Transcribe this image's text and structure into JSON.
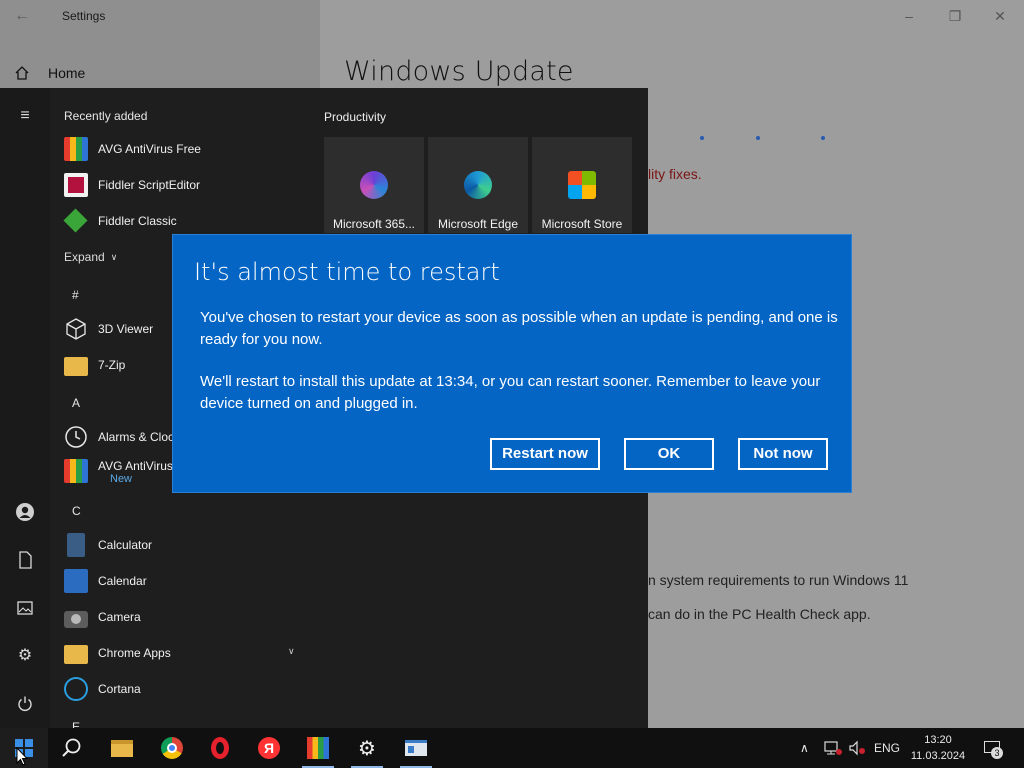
{
  "settings": {
    "window_title": "Settings",
    "home_label": "Home",
    "page_title": "Windows Update",
    "fragment_quality": "lity fixes.",
    "fragment_requirements": "n system requirements to run Windows 11",
    "fragment_health": "can do in the PC Health Check app."
  },
  "start_menu": {
    "recently_added_label": "Recently added",
    "recent": [
      {
        "label": "AVG AntiVirus Free",
        "icon": "avg-icon"
      },
      {
        "label": "Fiddler ScriptEditor",
        "icon": "fiddler-scripteditor-icon"
      },
      {
        "label": "Fiddler Classic",
        "icon": "fiddler-classic-icon"
      }
    ],
    "expand_label": "Expand",
    "sections": [
      {
        "header": "#",
        "apps": [
          {
            "label": "3D Viewer"
          },
          {
            "label": "7-Zip"
          }
        ]
      },
      {
        "header": "A",
        "apps": [
          {
            "label": "Alarms & Cloc"
          },
          {
            "label": "AVG AntiVirus",
            "badge": "New"
          }
        ]
      },
      {
        "header": "C",
        "apps": [
          {
            "label": "Calculator"
          },
          {
            "label": "Calendar"
          },
          {
            "label": "Camera"
          },
          {
            "label": "Chrome Apps"
          },
          {
            "label": "Cortana"
          }
        ]
      },
      {
        "header": "E"
      }
    ],
    "tiles_group": "Productivity",
    "tiles": [
      {
        "label": "Microsoft 365..."
      },
      {
        "label": "Microsoft Edge"
      },
      {
        "label": "Microsoft Store"
      }
    ]
  },
  "dialog": {
    "title": "It's almost time to restart",
    "paragraph1": "You've chosen to restart your device as soon as possible when an update is pending, and one is ready for you now.",
    "paragraph2": "We'll restart to install this update at 13:34, or you can restart sooner. Remember to leave your device turned on and plugged in.",
    "buttons": {
      "restart": "Restart now",
      "ok": "OK",
      "not_now": "Not now"
    },
    "accent_color": "#0565c4"
  },
  "taskbar": {
    "language": "ENG",
    "time": "13:20",
    "date": "11.03.2024",
    "notification_count": "3"
  }
}
